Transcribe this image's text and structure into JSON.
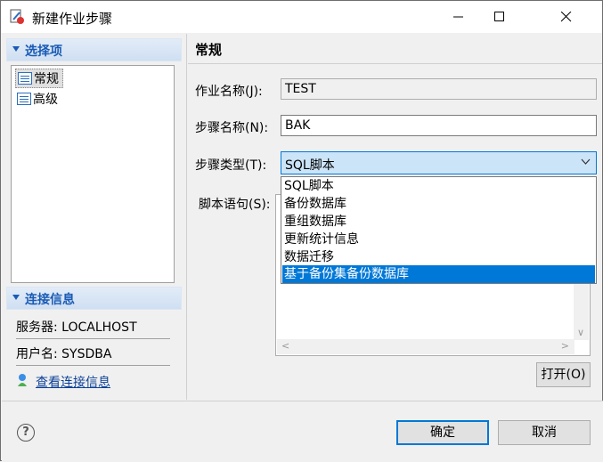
{
  "window": {
    "title": "新建作业步骤",
    "minimize_icon": "minimize-icon",
    "maximize_icon": "maximize-icon",
    "close_icon": "close-icon"
  },
  "left_panel": {
    "options_header": "选择项",
    "tree_items": [
      {
        "label": "常规",
        "icon": "list-icon",
        "selected": true
      },
      {
        "label": "高级",
        "icon": "list-icon",
        "selected": false
      }
    ],
    "connection_header": "连接信息",
    "server": "服务器: LOCALHOST",
    "user": "用户名: SYSDBA",
    "view_connection_link": "查看连接信息"
  },
  "right_panel": {
    "section_title": "常规",
    "job_name_label": "作业名称(J):",
    "job_name_value": "TEST",
    "step_name_label": "步骤名称(N):",
    "step_name_value": "BAK",
    "step_type_label": "步骤类型(T):",
    "step_type_value": "SQL脚本",
    "step_type_options": [
      "SQL脚本",
      "备份数据库",
      "重组数据库",
      "更新统计信息",
      "数据迁移",
      "基于备份集备份数据库"
    ],
    "highlighted_option": "基于备份集备份数据库",
    "script_label": "脚本语句(S):",
    "open_button": "打开(O)"
  },
  "footer": {
    "ok_button": "确定",
    "cancel_button": "取消",
    "help_icon": "help-icon"
  },
  "colors": {
    "accent": "#0078d7",
    "section_text": "#1a5bb5",
    "link": "#0b3f96"
  }
}
